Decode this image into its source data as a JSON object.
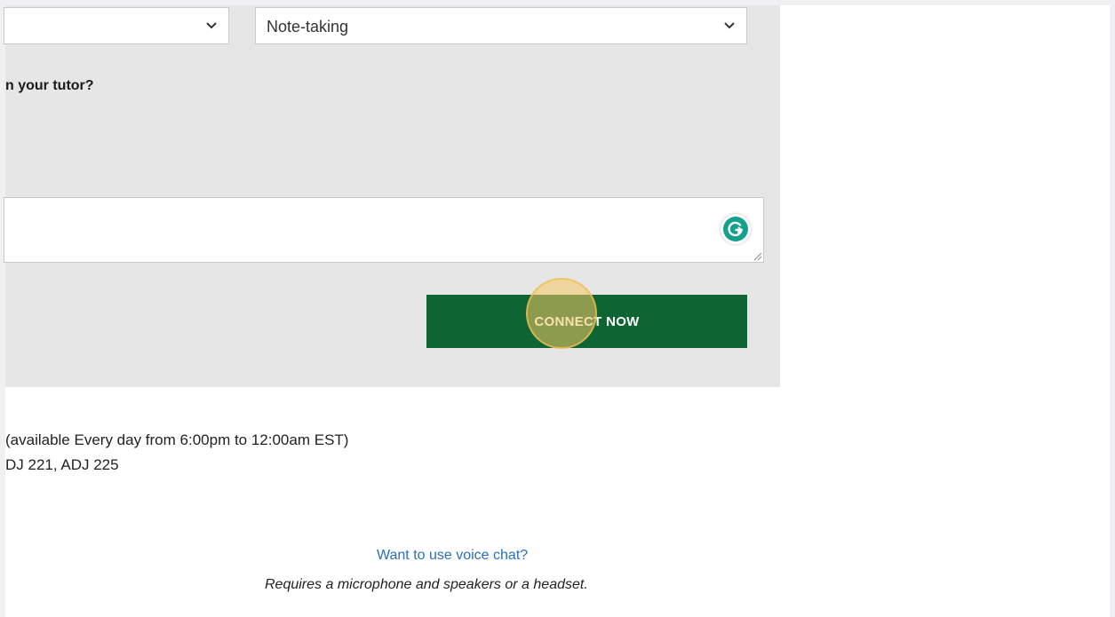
{
  "form": {
    "select_left": {
      "value": ""
    },
    "select_right": {
      "value": "Note-taking"
    },
    "question": "n your tutor?",
    "message": {
      "value": ""
    },
    "connect_label": "CONNECT NOW"
  },
  "info": {
    "line1": "(available Every day from 6:00pm to 12:00am EST)",
    "line2": "DJ 221, ADJ 225"
  },
  "voice": {
    "link": "Want to use voice chat?",
    "note": "Requires a microphone and speakers or a headset."
  },
  "icons": {
    "dropdown": "chevron-down-icon",
    "grammarly": "grammarly-icon",
    "resize": "resize-grip-icon"
  },
  "colors": {
    "panel_bg": "#e6e6e6",
    "button_green": "#0f6434",
    "link_blue": "#2a6fb5",
    "grammarly_teal": "#15a08c"
  }
}
